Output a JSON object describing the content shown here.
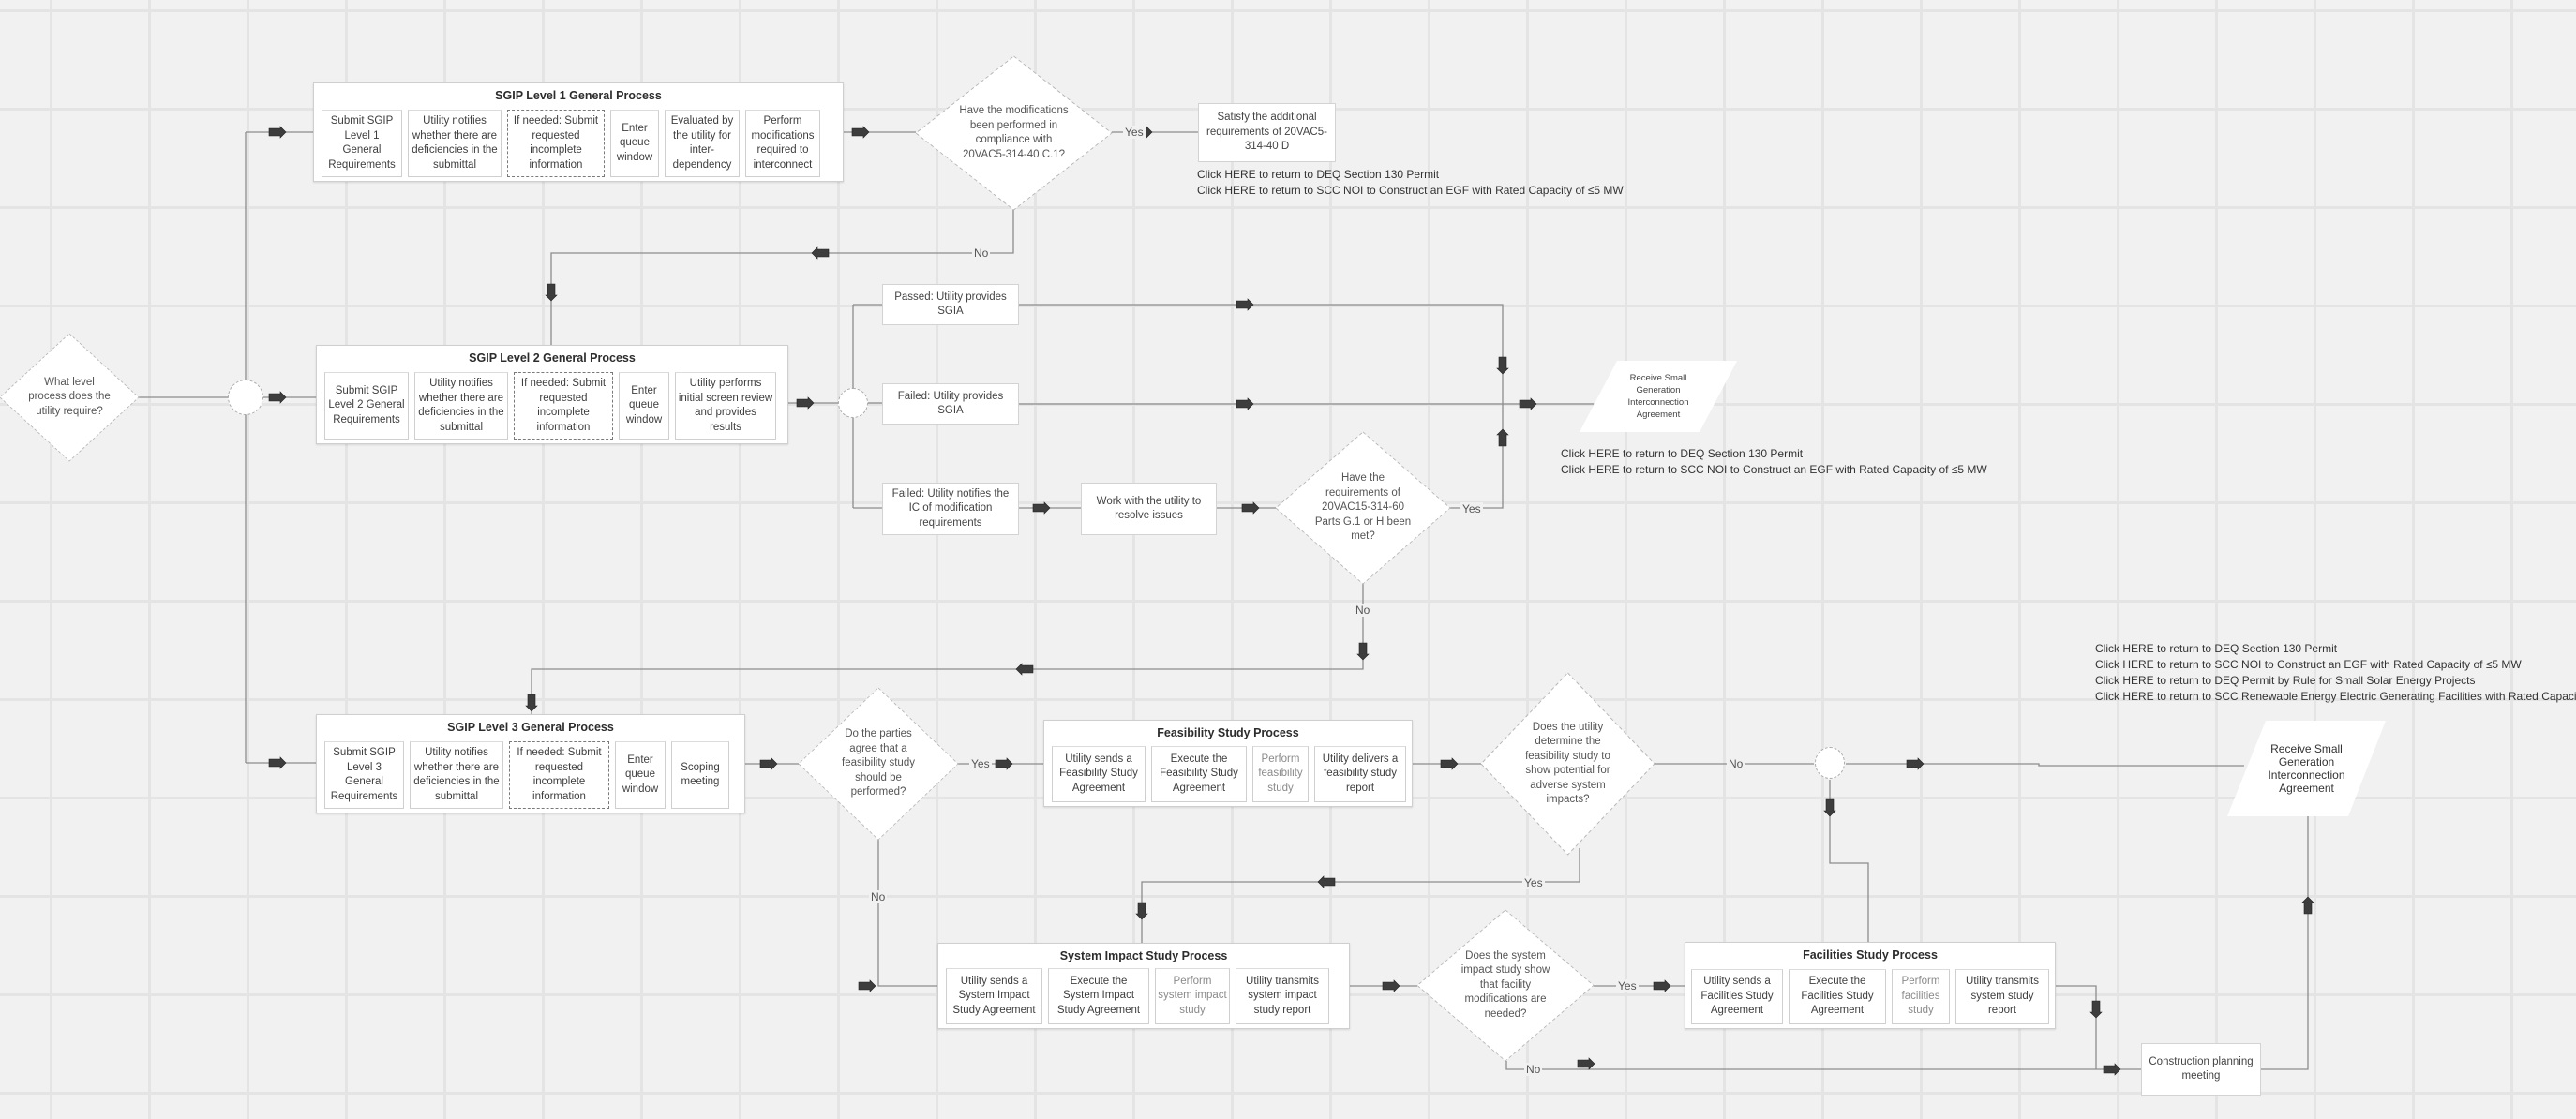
{
  "diagram": {
    "start_decision": "What level process does the utility require?",
    "level1": {
      "title": "SGIP Level 1 General Process",
      "steps": [
        "Submit SGIP Level 1 General Requirements",
        "Utility notifies whether there are deficiencies in the submittal",
        "If needed: Submit requested incomplete information",
        "Enter queue window",
        "Evaluated by the utility for inter-dependency",
        "Perform modifications required to interconnect"
      ]
    },
    "decision_mods": "Have the modifications been performed in compliance with 20VAC5-314-40 C.1?",
    "satisfy_box": "Satisfy the additional requirements of 20VAC5-314-40 D",
    "links_group1": [
      "Click HERE to return to DEQ Section 130 Permit",
      "Click HERE to return to SCC NOI to Construct an EGF with Rated Capacity of ≤5 MW"
    ],
    "level2": {
      "title": "SGIP Level 2 General Process",
      "steps": [
        "Submit SGIP Level 2 General Requirements",
        "Utility notifies whether there are deficiencies in the submittal",
        "If needed: Submit requested incomplete information",
        "Enter queue window",
        "Utility performs initial screen review and provides results"
      ]
    },
    "outcome_passed": "Passed: Utility provides SGIA",
    "outcome_failed_sgia": "Failed: Utility provides SGIA",
    "outcome_failed_notify": "Failed: Utility notifies the IC of modification requirements",
    "work_with_utility": "Work with the utility to resolve issues",
    "decision_requirements": "Have the requirements of 20VAC15-314-60 Parts G.1 or H been met?",
    "receive_sgia_1": "Receive Small Generation Interconnection Agreement",
    "links_group2": [
      "Click HERE to return to DEQ Section 130 Permit",
      "Click HERE to return to SCC NOI to Construct an EGF with Rated Capacity of ≤5 MW"
    ],
    "level3": {
      "title": "SGIP Level 3 General Process",
      "steps": [
        "Submit SGIP Level 3 General Requirements",
        "Utility notifies whether there are deficiencies in the submittal",
        "If needed: Submit requested incomplete information",
        "Enter queue window",
        "Scoping meeting"
      ]
    },
    "decision_feasibility_agree": "Do the parties agree that a feasibility study should be performed?",
    "feasibility": {
      "title": "Feasibility Study Process",
      "steps": [
        "Utility sends a Feasibility Study Agreement",
        "Execute the Feasibility Study Agreement",
        "Perform feasibility study",
        "Utility delivers a feasibility study report"
      ]
    },
    "decision_adverse": "Does the utility determine the feasibility study to show potential for adverse system impacts?",
    "receive_sgia_2": "Receive Small Generation Interconnection Agreement",
    "links_group3": [
      "Click HERE to return to DEQ Section 130 Permit",
      "Click HERE to return to SCC NOI to Construct an EGF with Rated Capacity of ≤5 MW",
      "Click HERE to return to DEQ Permit by Rule for Small Solar Energy Projects",
      "Click HERE to return to SCC Renewable Energy Electric Generating Facilities with Rated Capaciti"
    ],
    "system_impact": {
      "title": "System Impact Study Process",
      "steps": [
        "Utility sends a System Impact Study Agreement",
        "Execute the System Impact Study Agreement",
        "Perform system impact study",
        "Utility transmits system impact study report"
      ]
    },
    "decision_facility_mods": "Does the system impact study show that facility modifications are needed?",
    "facilities": {
      "title": "Facilities Study Process",
      "steps": [
        "Utility sends a Facilities Study Agreement",
        "Execute the Facilities Study Agreement",
        "Perform facilities study",
        "Utility transmits system study report"
      ]
    },
    "construction_meeting": "Construction planning meeting",
    "labels": {
      "yes": "Yes",
      "no": "No"
    }
  }
}
